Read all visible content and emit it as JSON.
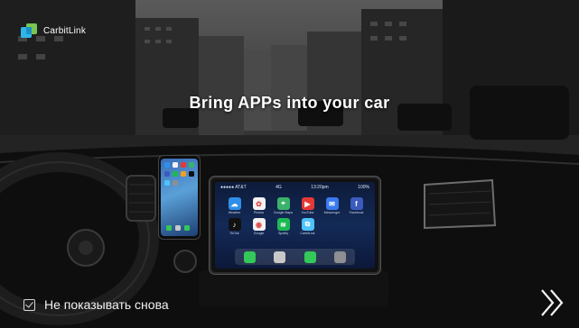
{
  "brand": {
    "name": "CarbitLink",
    "icon": "carbitlink-logo-icon"
  },
  "headline": "Bring APPs into your car",
  "car_screen": {
    "status": {
      "carrier": "●●●●● AT&T",
      "network": "4G",
      "time": "13:20pm",
      "battery": "100%"
    },
    "apps": [
      {
        "label": "Weather",
        "icon": "weather-icon",
        "color": "#2f8fe8",
        "glyph": "☁"
      },
      {
        "label": "Photos",
        "icon": "photos-icon",
        "color": "#f2f2f2",
        "glyph": "✿"
      },
      {
        "label": "Google Maps",
        "icon": "map-icon",
        "color": "#3bb26b",
        "glyph": "⌖"
      },
      {
        "label": "YouTube",
        "icon": "youtube-icon",
        "color": "#e53935",
        "glyph": "▶"
      },
      {
        "label": "Messenger",
        "icon": "messenger-icon",
        "color": "#3a7af0",
        "glyph": "✉"
      },
      {
        "label": "Facebook",
        "icon": "facebook-icon",
        "color": "#3b5bbd",
        "glyph": "f"
      },
      {
        "label": "TikTok",
        "icon": "tiktok-icon",
        "color": "#111111",
        "glyph": "♪"
      },
      {
        "label": "Google",
        "icon": "chrome-icon",
        "color": "#f3f3f3",
        "glyph": "◉"
      },
      {
        "label": "Spotify",
        "icon": "spotify-icon",
        "color": "#1db954",
        "glyph": "≋"
      },
      {
        "label": "CarbitLink",
        "icon": "carbitlink-app-icon",
        "color": "#4fc3f7",
        "glyph": "⧉"
      }
    ],
    "dock": [
      {
        "icon": "phone-icon",
        "color": "#34c759"
      },
      {
        "icon": "music-icon",
        "color": "#c8c8c8"
      },
      {
        "icon": "messages-icon",
        "color": "#34c759"
      },
      {
        "icon": "settings-icon",
        "color": "#8e8e93"
      }
    ]
  },
  "dont_show": {
    "label": "Не показывать снова",
    "checked": true
  },
  "next": {
    "icon": "double-chevron-right-icon"
  }
}
